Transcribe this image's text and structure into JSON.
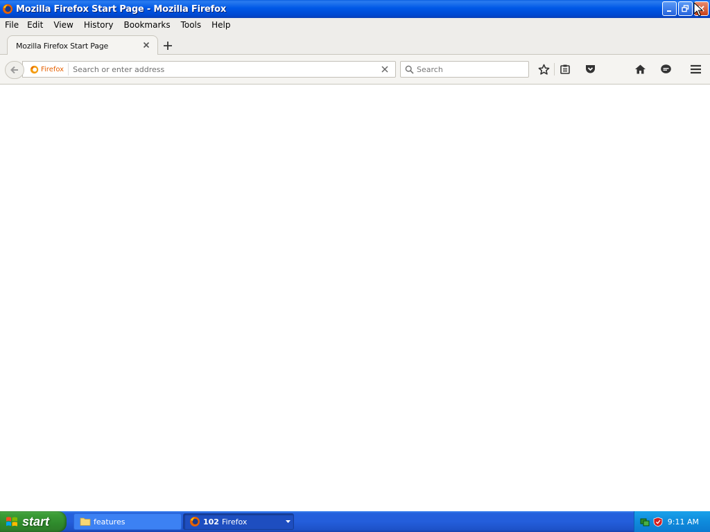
{
  "window": {
    "title": "Mozilla Firefox Start Page - Mozilla Firefox"
  },
  "menubar": {
    "items": [
      {
        "label": "File"
      },
      {
        "label": "Edit"
      },
      {
        "label": "View"
      },
      {
        "label": "History"
      },
      {
        "label": "Bookmarks"
      },
      {
        "label": "Tools"
      },
      {
        "label": "Help"
      }
    ]
  },
  "tabs": [
    {
      "label": "Mozilla Firefox Start Page",
      "active": true
    }
  ],
  "navbar": {
    "identity_label": "Firefox",
    "url_placeholder": "Search or enter address",
    "url_value": "",
    "search_placeholder": "Search"
  },
  "taskbar": {
    "start_label": "start",
    "buttons": [
      {
        "label": "features",
        "icon": "folder-icon"
      },
      {
        "count": "102",
        "label": "Firefox",
        "icon": "firefox-icon"
      }
    ],
    "clock": "9:11 AM"
  },
  "colors": {
    "titlebar": "#0058e6",
    "start_green": "#3c9d37",
    "taskbar_blue": "#245edb",
    "tray_blue": "#0f8bdc",
    "firefox_orange": "#e66000"
  }
}
